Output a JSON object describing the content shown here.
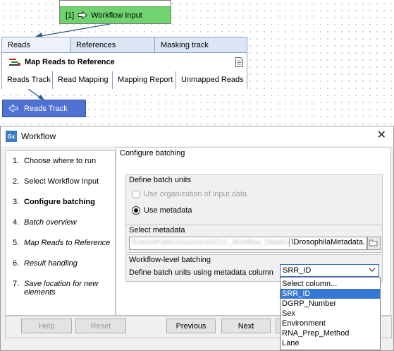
{
  "workflow_canvas": {
    "input_node": {
      "label": "[1]",
      "name": "Workflow Input"
    },
    "map_node": {
      "input_tabs": [
        "Reads",
        "References",
        "Masking track"
      ],
      "title": "Map Reads to Reference",
      "outputs": [
        "Reads Track",
        "Read Mapping",
        "Mapping Report",
        "Unmapped Reads"
      ]
    },
    "output_node": {
      "name": "Reads Track"
    }
  },
  "dialog": {
    "app_icon": "Gx",
    "title": "Workflow",
    "steps": [
      {
        "num": "1.",
        "label": "Choose where to run"
      },
      {
        "num": "2.",
        "label": "Select Workflow Input"
      },
      {
        "num": "3.",
        "label": "Configure batching"
      },
      {
        "num": "4.",
        "label": "Batch overview"
      },
      {
        "num": "5.",
        "label": "Map Reads to Reference"
      },
      {
        "num": "6.",
        "label": "Result handling"
      },
      {
        "num": "7.",
        "label": "Save location for new elements"
      }
    ],
    "content": {
      "heading": "Configure batching",
      "batch_units": {
        "label": "Define batch units",
        "option_org": "Use organization of input data",
        "option_meta": "Use metadata"
      },
      "select_metadata": {
        "label": "Select metadata",
        "path_blurred": "\\\\Users\\Public\\Documents\\CLC_Workflow_Data\\Folder\\",
        "path_visible": "\\DrosophilaMetadata."
      },
      "workflow_batching": {
        "label": "Workflow-level batching",
        "define_label": "Define batch units using metadata column",
        "selected_value": "SRR_ID"
      }
    },
    "dropdown_options": [
      "Select column...",
      "SRR_ID",
      "DGRP_Number",
      "Sex",
      "Environment",
      "RNA_Prep_Method",
      "Lane"
    ],
    "buttons": {
      "help": "Help",
      "reset": "Reset",
      "previous": "Previous",
      "next": "Next"
    }
  }
}
